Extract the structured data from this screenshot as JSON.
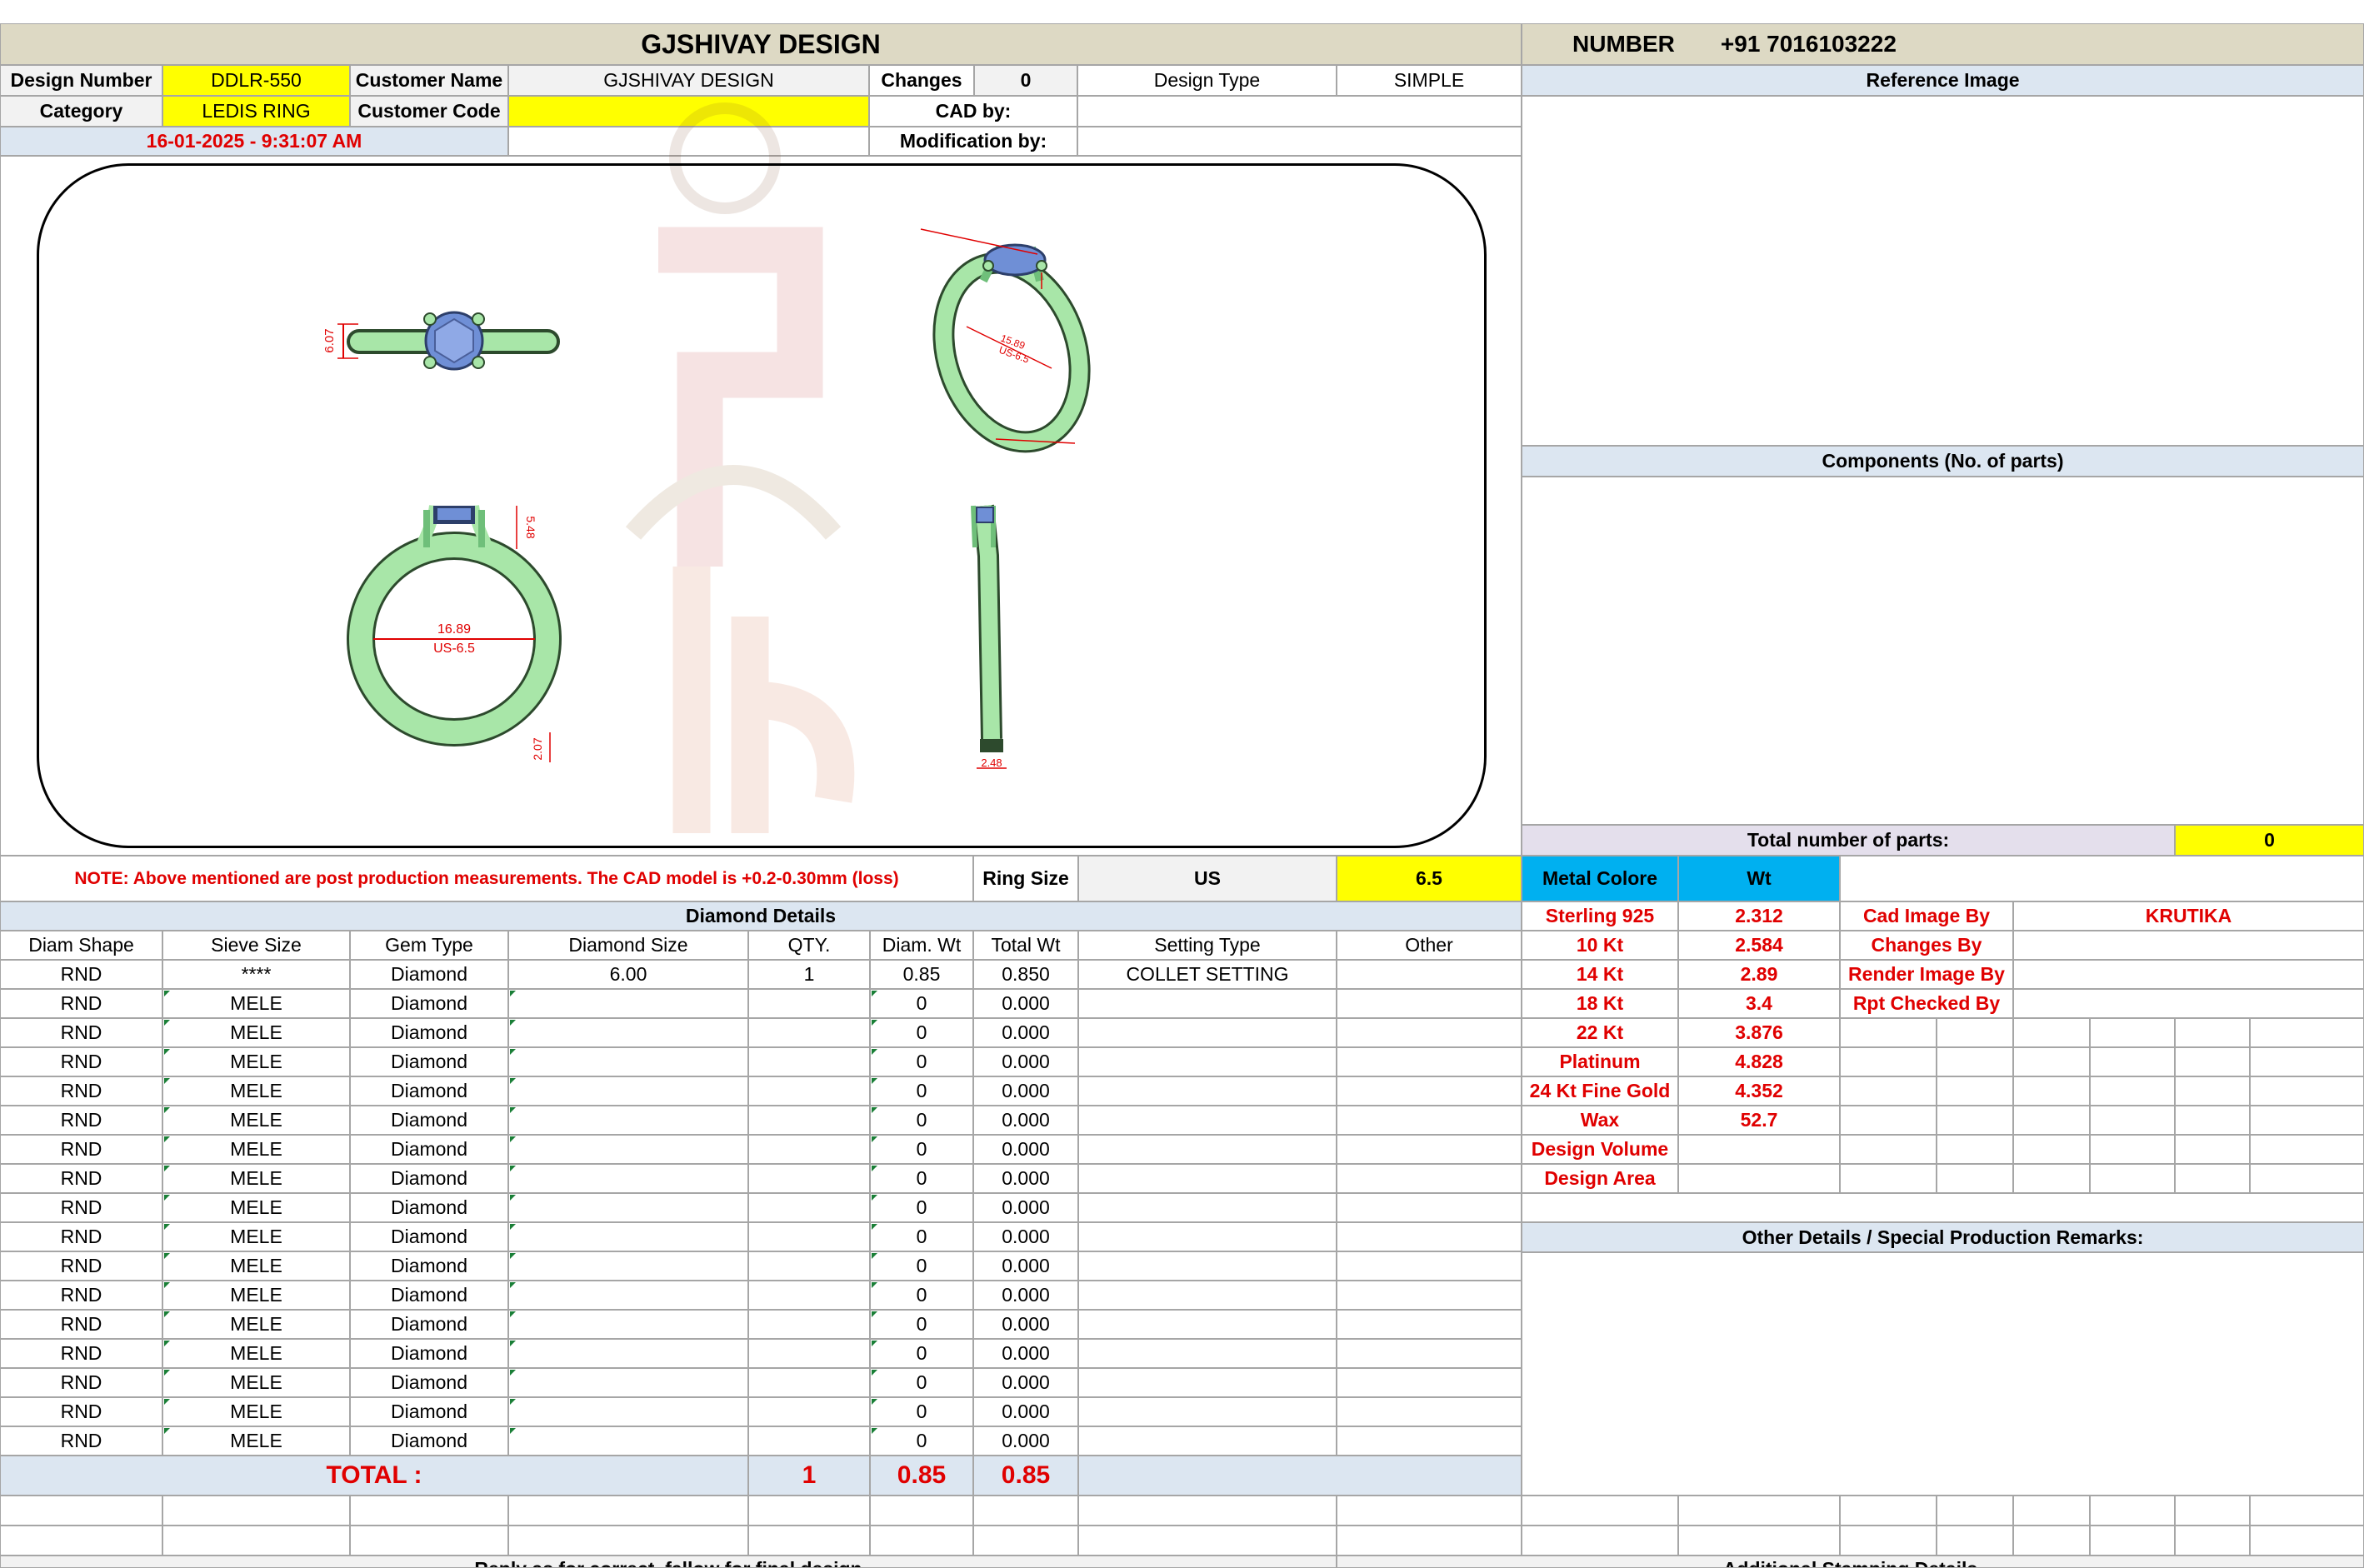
{
  "header": {
    "title": "GJSHIVAY DESIGN",
    "number_label": "NUMBER",
    "number_value": "+91 7016103222"
  },
  "info": {
    "design_number_label": "Design Number",
    "design_number_value": "DDLR-550",
    "customer_name_label": "Customer Name",
    "customer_name_value": "GJSHIVAY DESIGN",
    "changes_label": "Changes",
    "changes_value": "0",
    "design_type_label": "Design Type",
    "design_type_value": "SIMPLE",
    "category_label": "Category",
    "category_value": "LEDIS RING",
    "customer_code_label": "Customer Code",
    "customer_code_value": "",
    "cad_by_label": "CAD by:",
    "cad_by_value": "",
    "date_time": "16-01-2025 - 9:31:07 AM",
    "modification_label": "Modification by:",
    "modification_value": ""
  },
  "right_panel": {
    "reference_image_label": "Reference Image",
    "components_label": "Components (No. of parts)",
    "total_parts_label": "Total number of parts:",
    "total_parts_value": "0"
  },
  "drawing": {
    "dims": {
      "top_height": "6.07",
      "persp_inner": "15.89",
      "persp_size": "US-6.5",
      "front_inner": "16.89",
      "front_size": "US-6.5",
      "front_head": "5.48",
      "front_shank": "2.07",
      "side_width": "2.48"
    },
    "colors": {
      "metal": "#a8e6a8",
      "metal_dark": "#6fbf7a",
      "stone": "#6f8fd6",
      "dimension": "#e00000"
    }
  },
  "note": "NOTE: Above mentioned are post production measurements. The CAD model is +0.2-0.30mm (loss)",
  "ring_size": {
    "label": "Ring Size",
    "standard": "US",
    "value": "6.5"
  },
  "metal": {
    "colore_label": "Metal Colore",
    "wt_label": "Wt",
    "rows": [
      {
        "name": "Sterling 925",
        "wt": "2.312"
      },
      {
        "name": "10 Kt",
        "wt": "2.584"
      },
      {
        "name": "14 Kt",
        "wt": "2.89"
      },
      {
        "name": "18 Kt",
        "wt": "3.4"
      },
      {
        "name": "22 Kt",
        "wt": "3.876"
      },
      {
        "name": "Platinum",
        "wt": "4.828"
      },
      {
        "name": "24 Kt Fine Gold",
        "wt": "4.352"
      },
      {
        "name": "Wax",
        "wt": "52.7"
      },
      {
        "name": "Design Volume",
        "wt": ""
      },
      {
        "name": "Design Area",
        "wt": ""
      }
    ]
  },
  "credits": {
    "cad_image_label": "Cad Image By",
    "cad_image_value": "KRUTIKA",
    "changes_by_label": "Changes By",
    "render_image_label": "Render Image By",
    "rpt_checked_label": "Rpt Checked By"
  },
  "other_details_label": "Other Details / Special Production Remarks:",
  "diamond": {
    "title": "Diamond Details",
    "headers": [
      "Diam Shape",
      "Sieve Size",
      "Gem Type",
      "Diamond Size",
      "QTY.",
      "Diam. Wt",
      "Total Wt",
      "Setting Type",
      "Other"
    ],
    "rows": [
      [
        "RND",
        "****",
        "Diamond",
        "6.00",
        "1",
        "0.85",
        "0.850",
        "COLLET SETTING",
        ""
      ],
      [
        "RND",
        "MELE",
        "Diamond",
        "",
        "",
        "0",
        "0.000",
        "",
        ""
      ],
      [
        "RND",
        "MELE",
        "Diamond",
        "",
        "",
        "0",
        "0.000",
        "",
        ""
      ],
      [
        "RND",
        "MELE",
        "Diamond",
        "",
        "",
        "0",
        "0.000",
        "",
        ""
      ],
      [
        "RND",
        "MELE",
        "Diamond",
        "",
        "",
        "0",
        "0.000",
        "",
        ""
      ],
      [
        "RND",
        "MELE",
        "Diamond",
        "",
        "",
        "0",
        "0.000",
        "",
        ""
      ],
      [
        "RND",
        "MELE",
        "Diamond",
        "",
        "",
        "0",
        "0.000",
        "",
        ""
      ],
      [
        "RND",
        "MELE",
        "Diamond",
        "",
        "",
        "0",
        "0.000",
        "",
        ""
      ],
      [
        "RND",
        "MELE",
        "Diamond",
        "",
        "",
        "0",
        "0.000",
        "",
        ""
      ],
      [
        "RND",
        "MELE",
        "Diamond",
        "",
        "",
        "0",
        "0.000",
        "",
        ""
      ],
      [
        "RND",
        "MELE",
        "Diamond",
        "",
        "",
        "0",
        "0.000",
        "",
        ""
      ],
      [
        "RND",
        "MELE",
        "Diamond",
        "",
        "",
        "0",
        "0.000",
        "",
        ""
      ],
      [
        "RND",
        "MELE",
        "Diamond",
        "",
        "",
        "0",
        "0.000",
        "",
        ""
      ],
      [
        "RND",
        "MELE",
        "Diamond",
        "",
        "",
        "0",
        "0.000",
        "",
        ""
      ],
      [
        "RND",
        "MELE",
        "Diamond",
        "",
        "",
        "0",
        "0.000",
        "",
        ""
      ],
      [
        "RND",
        "MELE",
        "Diamond",
        "",
        "",
        "0",
        "0.000",
        "",
        ""
      ],
      [
        "RND",
        "MELE",
        "Diamond",
        "",
        "",
        "0",
        "0.000",
        "",
        ""
      ]
    ],
    "total_label": "TOTAL :",
    "total_qty": "1",
    "total_diam_wt": "0.85",
    "total_wt": "0.85"
  },
  "footer": {
    "left_text": "Reply as for correct, fallow for final design",
    "right_text": "Additional Stamping Details"
  }
}
